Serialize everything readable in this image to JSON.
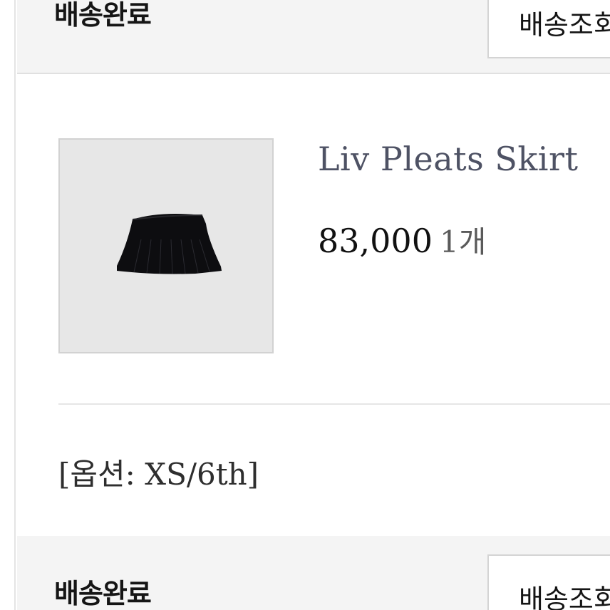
{
  "orders": [
    {
      "status": "배송완료",
      "track_button_label": "배송조회"
    },
    {
      "status": "배송완료",
      "track_button_label": "배송조회"
    }
  ],
  "item": {
    "name": "Liv Pleats Skirt",
    "price": "83,000",
    "quantity": "1개",
    "option": "[옵션: XS/6th]",
    "image": "black-pleated-skirt"
  },
  "colors": {
    "header_bg": "#f4f4f4",
    "thumbnail_bg": "#e7e7e7",
    "product_name": "#4e5264",
    "text": "#151515"
  }
}
